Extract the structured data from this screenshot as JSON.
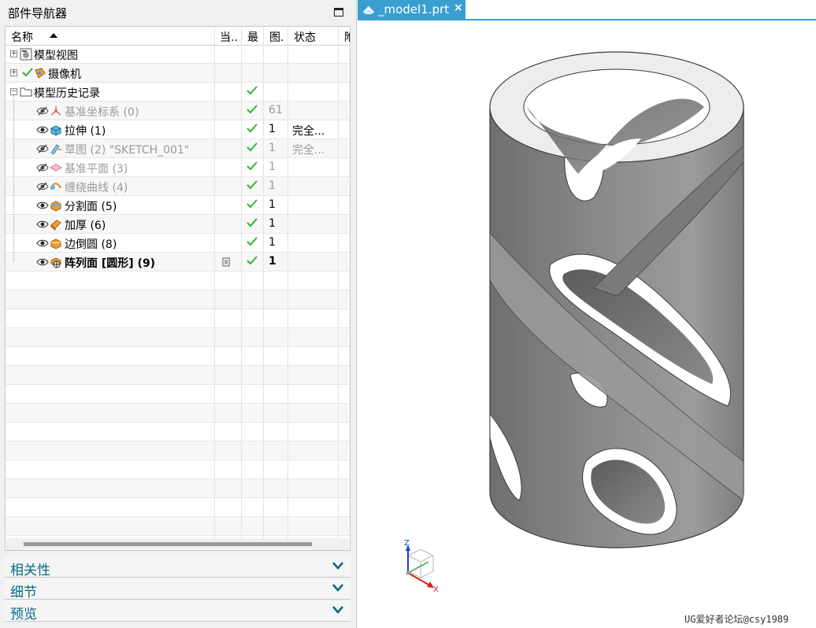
{
  "navigator": {
    "title": "部件导航器",
    "columns": [
      "名称",
      "当..",
      "最",
      "图.",
      "状态",
      "附"
    ],
    "rows": [
      {
        "label": "模型视图",
        "level": 0,
        "expand": "+",
        "icon": "model-views-icon"
      },
      {
        "label": "摄像机",
        "level": 0,
        "expand": "+",
        "icon": "camera-icon",
        "check_before": true
      },
      {
        "label": "模型历史记录",
        "level": 0,
        "expand": "−",
        "icon": "folder-icon",
        "latest": true
      },
      {
        "label": "基准坐标系 (0)",
        "level": 1,
        "icon": "datum-csys-icon",
        "hidden": true,
        "gray": true,
        "latest": true,
        "graph": "61"
      },
      {
        "label": "拉伸 (1)",
        "level": 1,
        "icon": "extrude-icon",
        "latest": true,
        "graph": "1",
        "status": "完全..."
      },
      {
        "label": "草图 (2) \"SKETCH_001\"",
        "level": 1,
        "icon": "sketch-icon",
        "hidden": true,
        "gray": true,
        "latest": true,
        "graph": "1",
        "status": "完全..."
      },
      {
        "label": "基准平面 (3)",
        "level": 1,
        "icon": "datum-plane-icon",
        "hidden": true,
        "gray": true,
        "latest": true,
        "graph": "1"
      },
      {
        "label": "缠绕曲线 (4)",
        "level": 1,
        "icon": "wrap-curve-icon",
        "hidden": true,
        "gray": true,
        "latest": true,
        "graph": "1"
      },
      {
        "label": "分割面 (5)",
        "level": 1,
        "icon": "divide-face-icon",
        "latest": true,
        "graph": "1"
      },
      {
        "label": "加厚 (6)",
        "level": 1,
        "icon": "thicken-icon",
        "latest": true,
        "graph": "1"
      },
      {
        "label": "边倒圆 (8)",
        "level": 1,
        "icon": "edge-blend-icon",
        "latest": true,
        "graph": "1"
      },
      {
        "label": "阵列面 [圆形] (9)",
        "level": 1,
        "icon": "pattern-face-icon",
        "latest": true,
        "graph": "1",
        "bold": true,
        "current": true
      }
    ],
    "sections": [
      "相关性",
      "细节",
      "预览"
    ]
  },
  "view": {
    "tab_title": "_model1.prt",
    "tab_close": "×",
    "triad_labels": {
      "x": "X",
      "y": "Y",
      "z": "Z"
    },
    "watermark": "UG爱好者论坛@csy1989"
  },
  "colors": {
    "accent": "#3a9fd0",
    "check": "#2db82d",
    "section_text": "#006a84",
    "model_fill": "#8c8c8c",
    "model_top": "#ededed"
  }
}
